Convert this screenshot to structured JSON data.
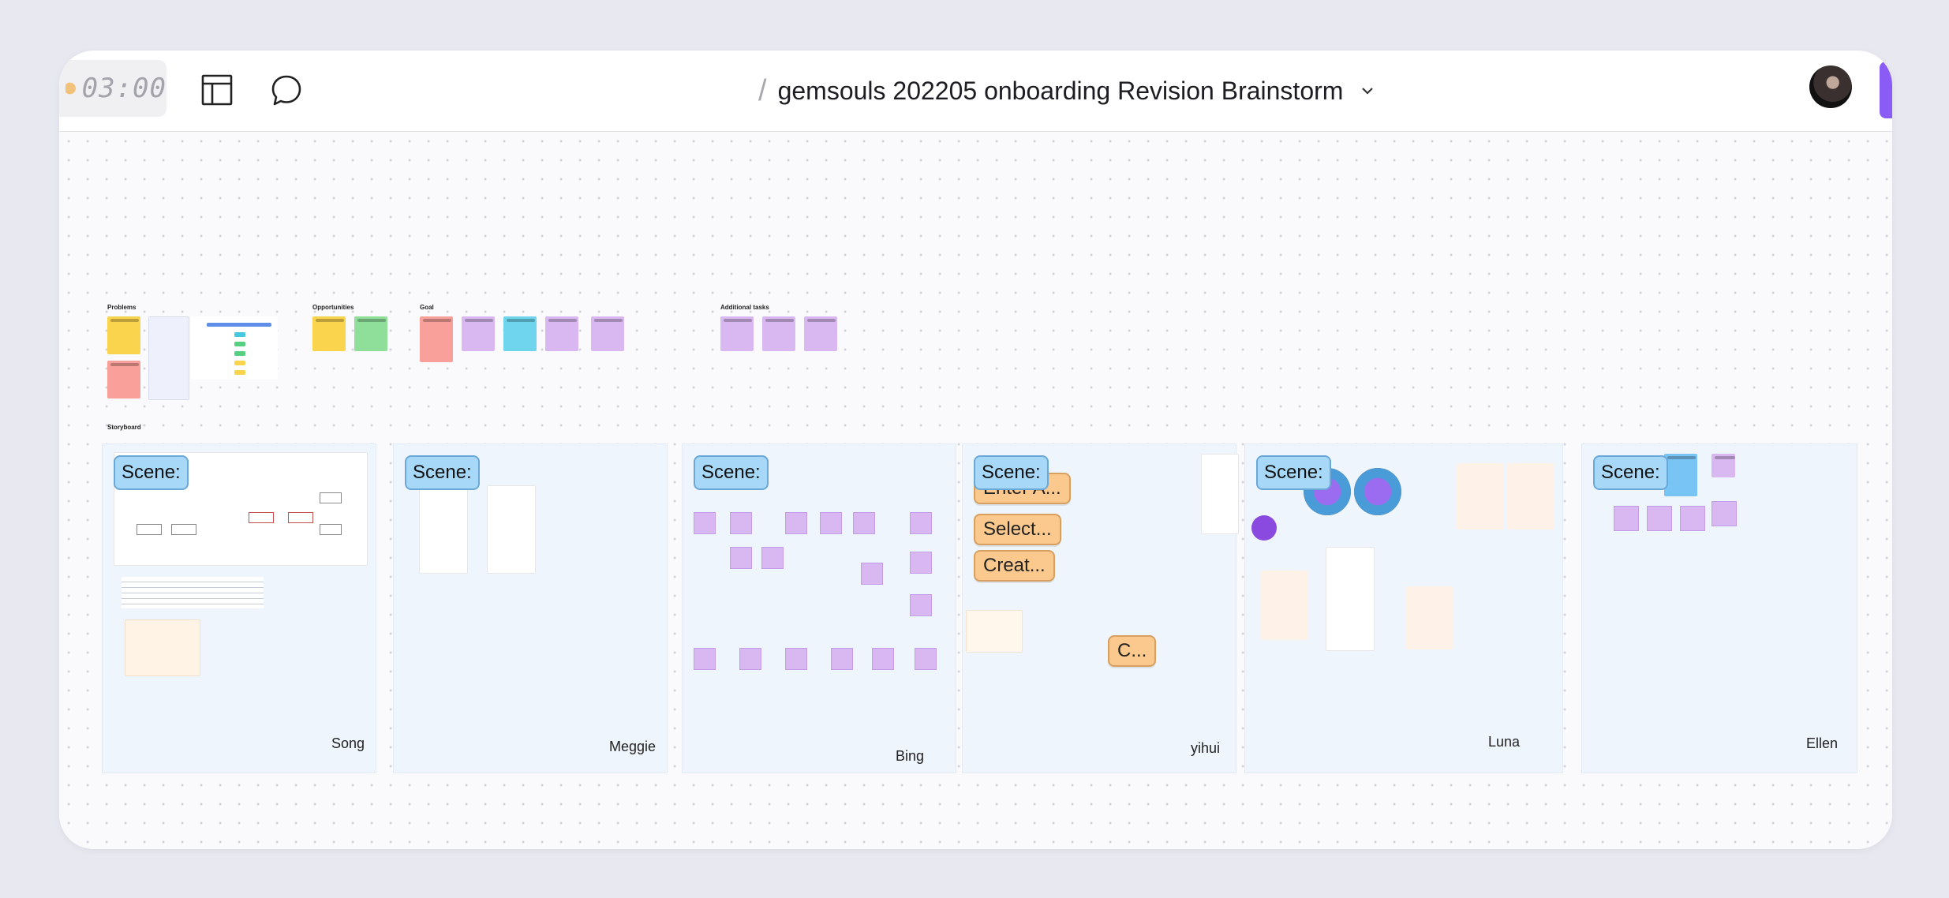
{
  "toolbar": {
    "timer": "03:00",
    "title": "gemsouls 202205 onboarding Revision Brainstorm",
    "separator": "/"
  },
  "board": {
    "sections": {
      "problems": "Problems",
      "opportunities": "Opportunities",
      "goal": "Goal",
      "additional_tasks": "Additional tasks",
      "storyboard": "Storyboard"
    },
    "frames": [
      {
        "scene": "Scene:",
        "owner": "Song"
      },
      {
        "scene": "Scene:",
        "owner": "Meggie"
      },
      {
        "scene": "Scene:",
        "owner": "Bing"
      },
      {
        "scene": "Scene:",
        "owner": "yihui"
      },
      {
        "scene": "Scene:",
        "owner": "Luna"
      },
      {
        "scene": "Scene:",
        "owner": "Ellen"
      }
    ],
    "yihui_buttons": [
      "Enter A...",
      "Select...",
      "Creat...",
      "C..."
    ]
  },
  "colors": {
    "accent": "#8a5cf5",
    "scene_badge": "#a8d8f8",
    "sticky_yellow": "#fbd44e",
    "sticky_red": "#f9a09a",
    "sticky_purple": "#d9b8f2",
    "sticky_cyan": "#6fd5ee",
    "sticky_green": "#8fdf9a"
  },
  "icons": {
    "layout": "layout-icon",
    "comment": "comment-icon",
    "chevron": "chevron-down-icon"
  }
}
